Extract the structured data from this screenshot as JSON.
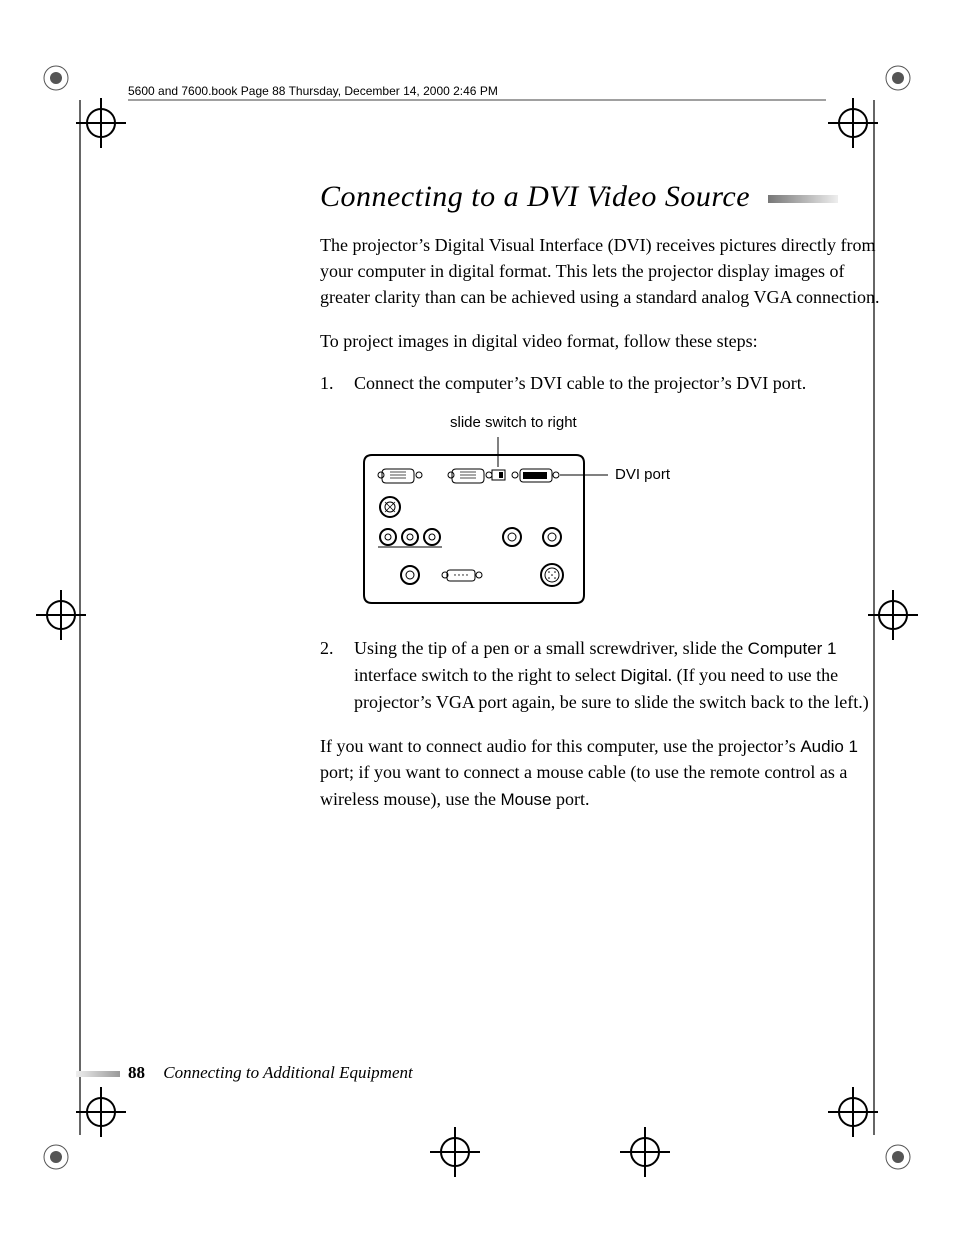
{
  "header": {
    "line": "5600 and 7600.book  Page 88  Thursday, December 14, 2000  2:46 PM"
  },
  "title": "Connecting to a DVI Video Source",
  "paragraphs": {
    "intro": "The projector’s Digital Visual Interface (DVI) receives pictures directly from your computer in digital format. This lets the projector display images of greater clarity than can be achieved using a standard analog VGA connection.",
    "lead": "To project images in digital video format, follow these steps:"
  },
  "steps": [
    {
      "num": "1.",
      "text": "Connect the computer’s DVI cable to the projector’s DVI port."
    },
    {
      "num": "2.",
      "parts": {
        "a": "Using the tip of a pen or a small screwdriver, slide the ",
        "comp1": "Computer 1",
        "b": " interface switch to the right to select ",
        "digital": "Digital",
        "c": ". (If you need to use the projector’s VGA port again, be sure to slide the switch back to the left.)"
      }
    }
  ],
  "diagram": {
    "caption": "slide switch to right",
    "dvi_label": "DVI port"
  },
  "closing": {
    "a": "If you want to connect audio for this computer, use the projector’s ",
    "audio1": "Audio 1",
    "b": " port; if you want to connect a mouse cable (to use the remote control as a wireless mouse), use the ",
    "mouse": "Mouse",
    "c": " port."
  },
  "footer": {
    "page": "88",
    "chapter": "Connecting to Additional Equipment"
  }
}
